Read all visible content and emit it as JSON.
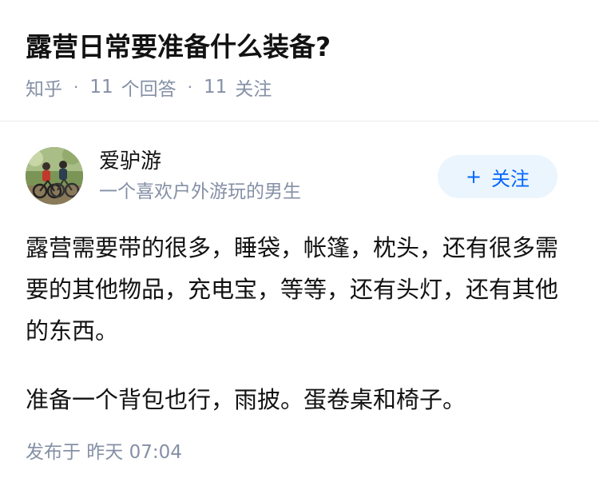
{
  "question": {
    "title": "露营日常要准备什么装备?",
    "source": "知乎",
    "separator": "·",
    "answers_count": "11",
    "answers_label": "个回答",
    "followers_count": "11",
    "followers_label": "关注"
  },
  "answer": {
    "author": {
      "name": "爱驴游",
      "bio": "一个喜欢户外游玩的男生"
    },
    "follow_button": {
      "icon": "+",
      "label": "关注"
    },
    "paragraphs": [
      "露营需要带的很多，睡袋，帐篷，枕头，还有很多需要的其他物品，充电宝，等等，还有头灯，还有其他的东西。",
      "准备一个背包也行，雨披。蛋卷桌和椅子。"
    ],
    "publish_time": "发布于  昨天 07:04"
  },
  "colors": {
    "title": "#121212",
    "meta": "#8590a6",
    "accent": "#0066ff",
    "follow_bg": "#ebf5fd",
    "divider": "#ebebeb"
  }
}
